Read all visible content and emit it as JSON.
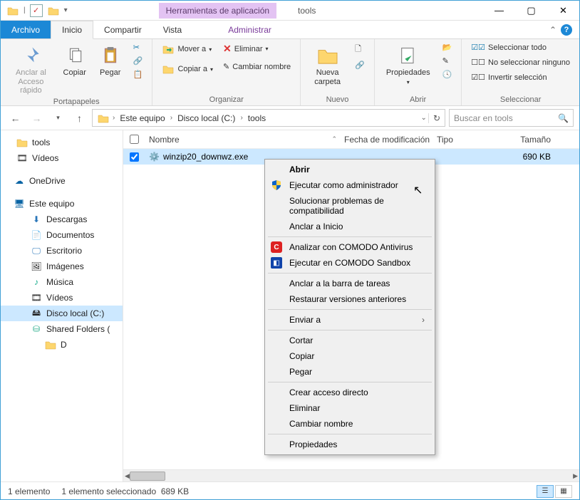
{
  "title": "tools",
  "contextual_tab": "Herramientas de aplicación",
  "window": {
    "min": "—",
    "max": "▢",
    "close": "✕"
  },
  "tabs": {
    "archivo": "Archivo",
    "inicio": "Inicio",
    "compartir": "Compartir",
    "vista": "Vista",
    "administrar": "Administrar"
  },
  "ribbon": {
    "anclar": "Anclar al Acceso rápido",
    "copiar": "Copiar",
    "pegar": "Pegar",
    "portapapeles": "Portapapeles",
    "mover": "Mover a",
    "copiar_a": "Copiar a",
    "eliminar": "Eliminar",
    "cambiar": "Cambiar nombre",
    "organizar": "Organizar",
    "nueva_carpeta": "Nueva carpeta",
    "nuevo": "Nuevo",
    "propiedades": "Propiedades",
    "abrir": "Abrir",
    "sel_todo": "Seleccionar todo",
    "sel_nada": "No seleccionar ninguno",
    "sel_inv": "Invertir selección",
    "seleccionar": "Seleccionar"
  },
  "breadcrumb": {
    "equipo": "Este equipo",
    "disco": "Disco local (C:)",
    "folder": "tools"
  },
  "search_placeholder": "Buscar en tools",
  "tree": {
    "tools": "tools",
    "videos": "Vídeos",
    "onedrive": "OneDrive",
    "equipo": "Este equipo",
    "descargas": "Descargas",
    "documentos": "Documentos",
    "escritorio": "Escritorio",
    "imagenes": "Imágenes",
    "musica": "Música",
    "videos2": "Vídeos",
    "disco": "Disco local (C:)",
    "shared": "Shared Folders (",
    "d": "D"
  },
  "columns": {
    "nombre": "Nombre",
    "fecha": "Fecha de modificación",
    "tipo": "Tipo",
    "tamano": "Tamaño"
  },
  "file": {
    "name": "winzip20_downwz.exe",
    "size": "690 KB"
  },
  "context": {
    "abrir": "Abrir",
    "admin": "Ejecutar como administrador",
    "compat": "Solucionar problemas de compatibilidad",
    "anclar_inicio": "Anclar a Inicio",
    "comodo_av": "Analizar con COMODO Antivirus",
    "comodo_sb": "Ejecutar en COMODO Sandbox",
    "anclar_barra": "Anclar a la barra de tareas",
    "restaurar": "Restaurar versiones anteriores",
    "enviar": "Enviar a",
    "cortar": "Cortar",
    "copiar": "Copiar",
    "pegar": "Pegar",
    "acceso_directo": "Crear acceso directo",
    "eliminar": "Eliminar",
    "cambiar": "Cambiar nombre",
    "propiedades": "Propiedades"
  },
  "status": {
    "count": "1 elemento",
    "selection": "1 elemento seleccionado",
    "size": "689 KB"
  }
}
